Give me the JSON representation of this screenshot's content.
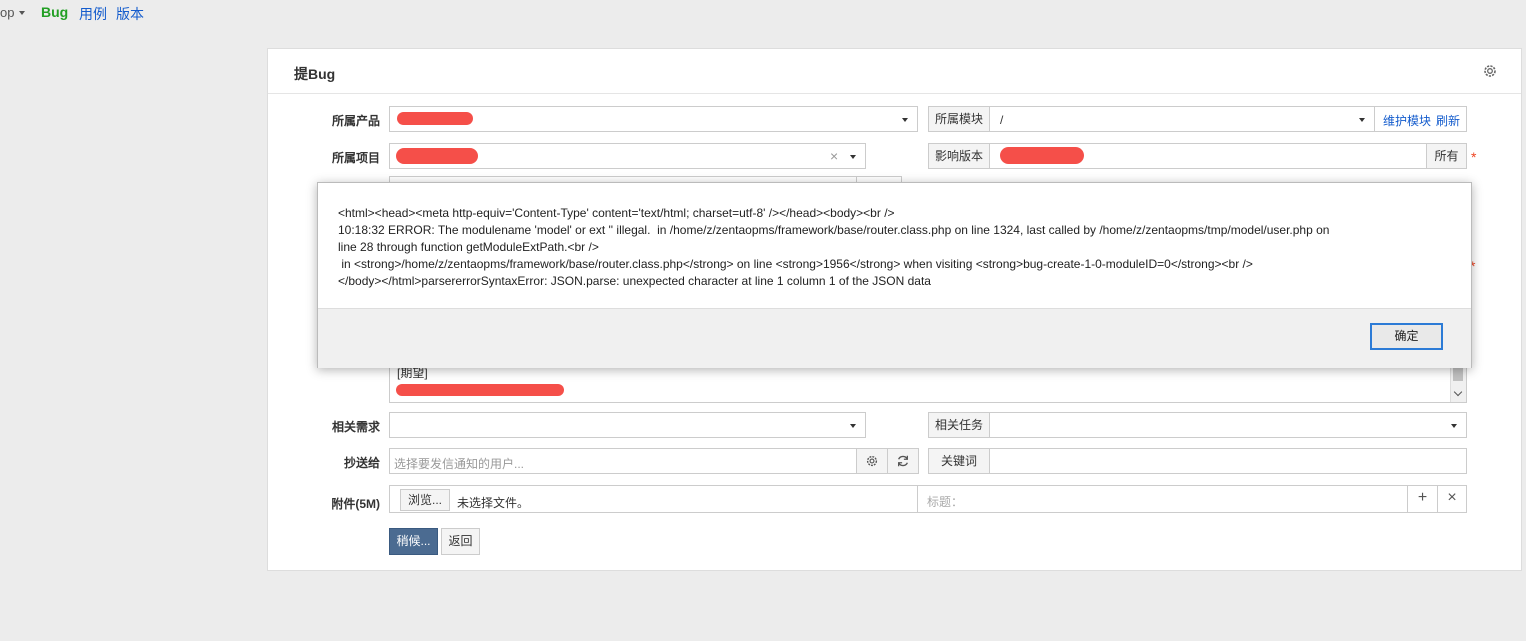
{
  "nav": {
    "partial": "op",
    "bug": "Bug",
    "case": "用例",
    "build": "版本"
  },
  "panel": {
    "title": "提Bug"
  },
  "form": {
    "product_label": "所属产品",
    "module_label": "所属模块",
    "module_value": "/",
    "maintain_module": "维护模块",
    "refresh": "刷新",
    "project_label": "所属项目",
    "clear": "×",
    "build_label": "影响版本",
    "build_all": "所有",
    "expect_text": "[期望]",
    "story_label": "相关需求",
    "task_label": "相关任务",
    "mailto_label": "抄送给",
    "mailto_placeholder": "选择要发信通知的用户...",
    "keywords_label": "关键词",
    "files_label": "附件(5M)",
    "browse": "浏览...",
    "no_file": "未选择文件。",
    "title_placeholder": "标题：",
    "add": "+",
    "remove": "×",
    "save": "稍候...",
    "back": "返回",
    "required": "*"
  },
  "modal": {
    "message": "<html><head><meta http-equiv='Content-Type' content='text/html; charset=utf-8' /></head><body><br />\n10:18:32 ERROR: The modulename 'model' or ext '' illegal.  in /home/z/zentaopms/framework/base/router.class.php on line 1324, last called by /home/z/zentaopms/tmp/model/user.php on\nline 28 through function getModuleExtPath.<br />\n in <strong>/home/z/zentaopms/framework/base/router.class.php</strong> on line <strong>1956</strong> when visiting <strong>bug-create-1-0-moduleID=0</strong><br />\n</body></html>parsererrorSyntaxError: JSON.parse: unexpected character at line 1 column 1 of the JSON data",
    "ok": "确定"
  },
  "colors": {
    "accent": "#145ccd",
    "nav_active": "#229f24",
    "save_button": "#4b6b91",
    "redaction": "#f4403a"
  }
}
